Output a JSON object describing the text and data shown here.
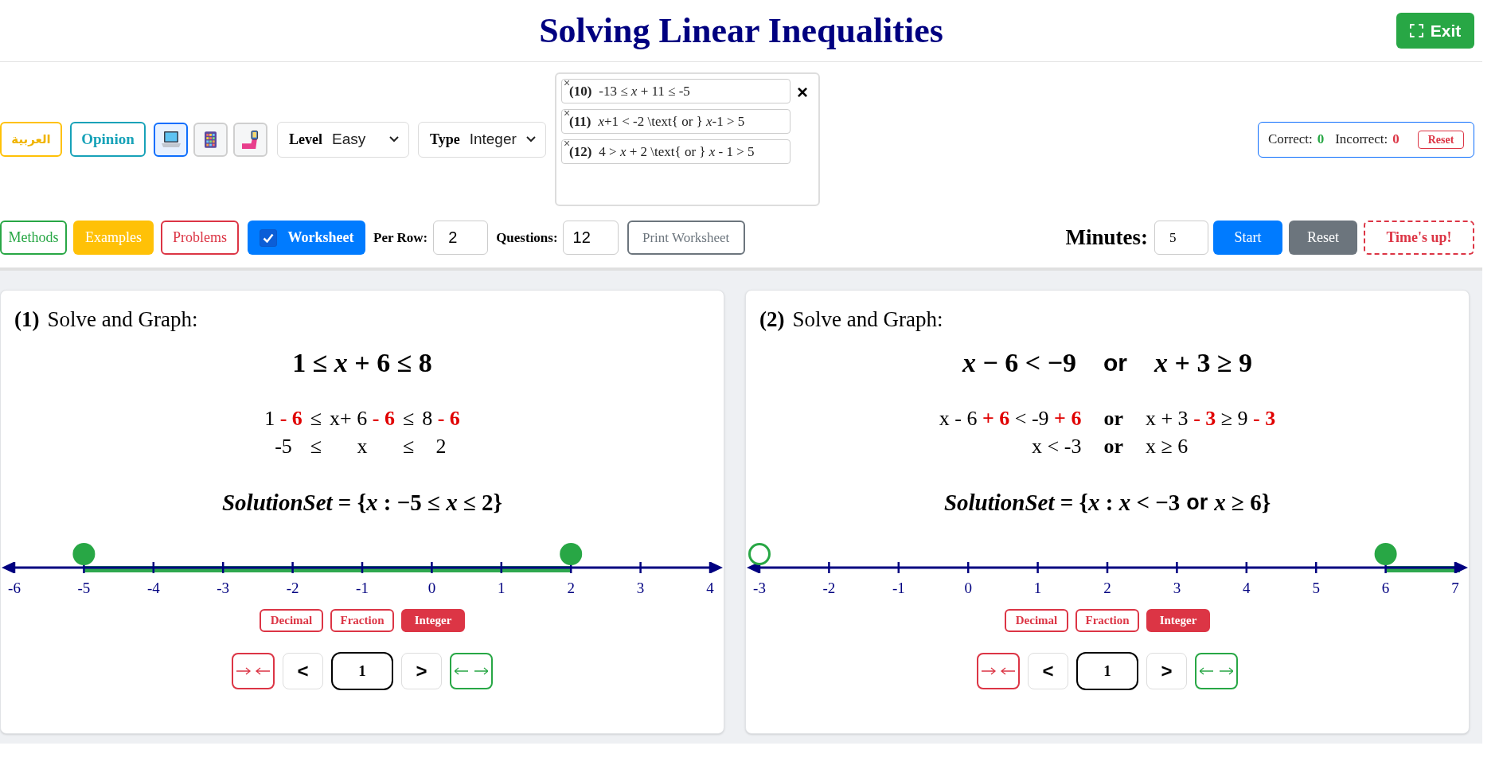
{
  "header": {
    "title": "Solving Linear Inequalities",
    "exit_button": "Exit"
  },
  "toolbar": {
    "language_button": "العربية",
    "opinion_button": "Opinion",
    "view_buttons": [
      {
        "kind": "laptop",
        "selected": true
      },
      {
        "kind": "keypad",
        "selected": false
      },
      {
        "kind": "phone",
        "selected": false
      }
    ],
    "level": {
      "label": "Level",
      "value": "Easy"
    },
    "type": {
      "label": "Type",
      "value": "Integer"
    },
    "problem_list": {
      "items": [
        {
          "remove": "×",
          "number": "(10)",
          "text": "-13 ≤ *x* + 11 ≤ -5"
        },
        {
          "remove": "×",
          "number": "(11)",
          "text": "*x*+1 < -2 \\text{ or } *x*-1 > 5"
        },
        {
          "remove": "×",
          "number": "(12)",
          "text": "4 > *x* + 2 \\text{ or } *x* - 1 > 5"
        }
      ],
      "close": "×"
    },
    "score": {
      "correct_label": "Correct:",
      "correct": "0",
      "incorrect_label": "Incorrect:",
      "incorrect": "0",
      "reset_button": "Reset"
    },
    "methods_button": "Methods",
    "examples_button": "Examples",
    "problems_button": "Problems",
    "worksheet": {
      "label": "Worksheet",
      "checked": true
    },
    "per_row": {
      "label": "Per Row:",
      "value": "2"
    },
    "questions": {
      "label": "Questions:",
      "value": "12"
    },
    "print_button": "Print Worksheet",
    "timer": {
      "label": "Minutes:",
      "value": "5",
      "start_button": "Start",
      "reset_button": "Reset",
      "status": "Time's up!"
    }
  },
  "problems": [
    {
      "number": "(1)",
      "prompt": "Solve and Graph:",
      "equation": [
        {
          "kind": "math",
          "text": "1 ≤ *x* + 6 ≤ 8"
        }
      ],
      "steps": [
        [
          {
            "kind": "math",
            "text": "1 **- 6**"
          },
          {
            "kind": "math",
            "text": "≤"
          },
          {
            "kind": "math",
            "text": "x+ 6 **- 6**"
          },
          {
            "kind": "math",
            "text": "≤"
          },
          {
            "kind": "math",
            "text": "8 **- 6**"
          }
        ],
        [
          {
            "kind": "math",
            "text": "-5"
          },
          {
            "kind": "math",
            "text": "≤"
          },
          {
            "kind": "math",
            "text": "x"
          },
          {
            "kind": "math",
            "text": "≤"
          },
          {
            "kind": "math",
            "text": "2"
          }
        ]
      ],
      "solution": [
        {
          "kind": "math",
          "text": "*SolutionSet* = {*x* : −5 ≤ *x* ≤ 2}"
        }
      ],
      "number_line": {
        "ticks": [
          {
            "label": "-6",
            "closed_dot": false,
            "open_dot": false,
            "shaded": false
          },
          {
            "label": "-5",
            "closed_dot": true,
            "open_dot": false,
            "shaded": true
          },
          {
            "label": "-4",
            "closed_dot": false,
            "open_dot": false,
            "shaded": true
          },
          {
            "label": "-3",
            "closed_dot": false,
            "open_dot": false,
            "shaded": true
          },
          {
            "label": "-2",
            "closed_dot": false,
            "open_dot": false,
            "shaded": true
          },
          {
            "label": "-1",
            "closed_dot": false,
            "open_dot": false,
            "shaded": true
          },
          {
            "label": "0",
            "closed_dot": false,
            "open_dot": false,
            "shaded": true
          },
          {
            "label": "1",
            "closed_dot": false,
            "open_dot": false,
            "shaded": true
          },
          {
            "label": "2",
            "closed_dot": true,
            "open_dot": false,
            "shaded": false
          },
          {
            "label": "3",
            "closed_dot": false,
            "open_dot": false,
            "shaded": false
          },
          {
            "label": "4",
            "closed_dot": false,
            "open_dot": false,
            "shaded": false
          }
        ]
      },
      "formats": [
        {
          "label": "Decimal",
          "selected": false
        },
        {
          "label": "Fraction",
          "selected": false
        },
        {
          "label": "Integer",
          "selected": true
        }
      ],
      "prev_button": "<",
      "page": "1",
      "next_button": ">"
    },
    {
      "number": "(2)",
      "prompt": "Solve and Graph:",
      "equation": [
        {
          "kind": "math",
          "text": "*x* − 6 < −9"
        },
        {
          "kind": "word",
          "text": "or"
        },
        {
          "kind": "math",
          "text": "*x* + 3 ≥ 9"
        }
      ],
      "steps": [
        [
          {
            "kind": "math",
            "text": "x - 6 **+ 6** < -9 **+ 6**"
          },
          {
            "kind": "word",
            "text": "or"
          },
          {
            "kind": "math",
            "text": "x + 3 **- 3** ≥ 9 **- 3**"
          }
        ],
        [
          {
            "kind": "math",
            "text": "x < -3"
          },
          {
            "kind": "word",
            "text": "or"
          },
          {
            "kind": "math",
            "text": "x ≥ 6"
          }
        ]
      ],
      "solution": [
        {
          "kind": "math",
          "text": "*SolutionSet* = {*x* : *x* < −3"
        },
        {
          "kind": "word",
          "text": "or"
        },
        {
          "kind": "math",
          "text": "*x* ≥ 6}"
        }
      ],
      "number_line": {
        "ticks": [
          {
            "label": "-3",
            "closed_dot": false,
            "open_dot": true,
            "shaded": false
          },
          {
            "label": "-2",
            "closed_dot": false,
            "open_dot": false,
            "shaded": false
          },
          {
            "label": "-1",
            "closed_dot": false,
            "open_dot": false,
            "shaded": false
          },
          {
            "label": "0",
            "closed_dot": false,
            "open_dot": false,
            "shaded": false
          },
          {
            "label": "1",
            "closed_dot": false,
            "open_dot": false,
            "shaded": false
          },
          {
            "label": "2",
            "closed_dot": false,
            "open_dot": false,
            "shaded": false
          },
          {
            "label": "3",
            "closed_dot": false,
            "open_dot": false,
            "shaded": false
          },
          {
            "label": "4",
            "closed_dot": false,
            "open_dot": false,
            "shaded": false
          },
          {
            "label": "5",
            "closed_dot": false,
            "open_dot": false,
            "shaded": false
          },
          {
            "label": "6",
            "closed_dot": true,
            "open_dot": false,
            "shaded": true
          },
          {
            "label": "7",
            "closed_dot": false,
            "open_dot": false,
            "shaded": true
          }
        ]
      },
      "formats": [
        {
          "label": "Decimal",
          "selected": false
        },
        {
          "label": "Fraction",
          "selected": false
        },
        {
          "label": "Integer",
          "selected": true
        }
      ],
      "prev_button": "<",
      "page": "1",
      "next_button": ">"
    }
  ]
}
